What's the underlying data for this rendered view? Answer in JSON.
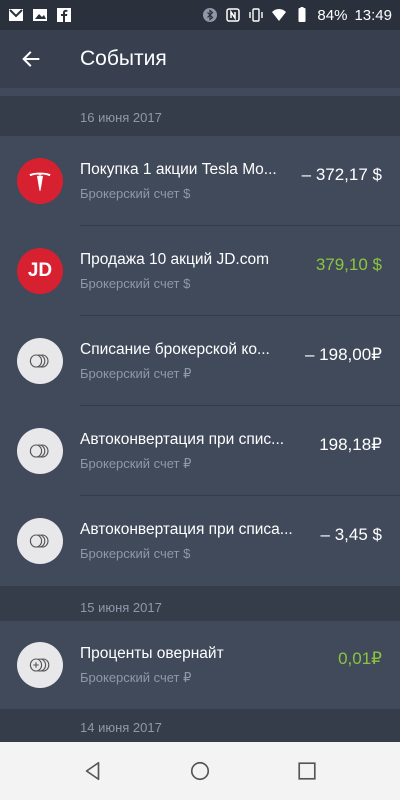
{
  "status_bar": {
    "left_icons": [
      "gmail-icon",
      "image-icon",
      "facebook-icon"
    ],
    "right_icons": [
      "bluetooth-icon",
      "nfc-icon",
      "vibrate-icon",
      "wifi-icon",
      "battery-icon"
    ],
    "battery": "84%",
    "time": "13:49"
  },
  "app_bar": {
    "back_icon": "arrow-back-icon",
    "title": "События"
  },
  "groups": [
    {
      "date": "16 июня 2017",
      "items": [
        {
          "icon": "tesla-icon",
          "title": "Покупка 1 акции Tesla Mo...",
          "subtitle": "Брокерский счет $",
          "amount": "– 372,17 $",
          "amount_color": "#ffffff"
        },
        {
          "icon": "jd-icon",
          "icon_text": "JD",
          "title": "Продажа 10 акций JD.com",
          "subtitle": "Брокерский счет $",
          "amount": "379,10 $",
          "amount_color": "#8ac540"
        },
        {
          "icon": "coins-icon",
          "title": "Списание брокерской ко...",
          "subtitle": "Брокерский счет ₽",
          "amount": "– 198,00₽",
          "amount_color": "#ffffff"
        },
        {
          "icon": "coins-icon",
          "title": "Автоконвертация при спис...",
          "subtitle": "Брокерский счет ₽",
          "amount": "198,18₽",
          "amount_color": "#ffffff"
        },
        {
          "icon": "coins-icon",
          "title": "Автоконвертация при списа...",
          "subtitle": "Брокерский счет $",
          "amount": "– 3,45 $",
          "amount_color": "#ffffff"
        }
      ]
    },
    {
      "date": "15 июня 2017",
      "items": [
        {
          "icon": "coins-plus-icon",
          "title": "Проценты овернайт",
          "subtitle": "Брокерский счет ₽",
          "amount": "0,01₽",
          "amount_color": "#8ac540"
        }
      ]
    },
    {
      "date": "14 июня 2017",
      "items": []
    }
  ],
  "nav_bar": {
    "icons": [
      "nav-back-icon",
      "nav-home-icon",
      "nav-recents-icon"
    ]
  },
  "colors": {
    "background": "#414a5a",
    "app_bar": "#384050",
    "date_header": "#363d4a",
    "positive": "#8ac540",
    "tesla_red": "#d72030"
  }
}
